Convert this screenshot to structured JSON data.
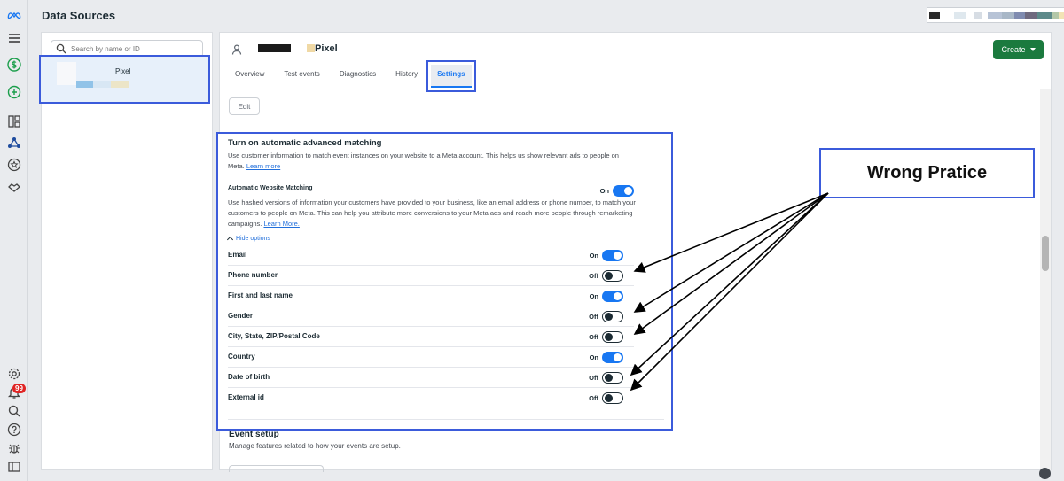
{
  "header": {
    "title": "Data Sources"
  },
  "rail": {
    "notification_count": "99",
    "icons": [
      "meta-logo-icon",
      "menu-icon",
      "dollar-icon",
      "add-icon",
      "grid-icon",
      "events-manager-icon",
      "star-icon",
      "partner-icon",
      "settings-icon",
      "notifications-icon",
      "search-icon",
      "help-icon",
      "bug-icon",
      "panel-icon"
    ]
  },
  "left_panel": {
    "search_placeholder": "Search by name or ID",
    "items": [
      {
        "label": "Pixel"
      }
    ]
  },
  "dataset": {
    "name": "Pixel",
    "create_label": "Create"
  },
  "tabs": [
    {
      "label": "Overview"
    },
    {
      "label": "Test events"
    },
    {
      "label": "Diagnostics"
    },
    {
      "label": "History"
    },
    {
      "label": "Settings",
      "active": true
    }
  ],
  "edit_label": "Edit",
  "matching": {
    "title": "Turn on automatic advanced matching",
    "description": "Use customer information to match event instances on your website to a Meta account. This helps us show relevant ads to people on Meta.",
    "learn_more": "Learn more",
    "awm_title": "Automatic Website Matching",
    "awm_state": "On",
    "awm_description": "Use hashed versions of information your customers have provided to your business, like an email address or phone number, to match your customers to people on Meta. This can help you attribute more conversions to your Meta ads and reach more people through remarketing campaigns.",
    "awm_learn_more": "Learn More.",
    "hide_options": "Hide options",
    "fields": [
      {
        "label": "Email",
        "state": "On"
      },
      {
        "label": "Phone number",
        "state": "Off"
      },
      {
        "label": "First and last name",
        "state": "On"
      },
      {
        "label": "Gender",
        "state": "Off"
      },
      {
        "label": "City, State, ZIP/Postal Code",
        "state": "Off"
      },
      {
        "label": "Country",
        "state": "On"
      },
      {
        "label": "Date of birth",
        "state": "Off"
      },
      {
        "label": "External id",
        "state": "Off"
      }
    ]
  },
  "event_setup": {
    "title": "Event setup",
    "description": "Manage features related to how your events are setup."
  },
  "annotation": {
    "text": "Wrong Pratice"
  },
  "colors": {
    "accent": "#1877f2",
    "create": "#1b7a3e",
    "highlight": "#3b5bdb"
  }
}
